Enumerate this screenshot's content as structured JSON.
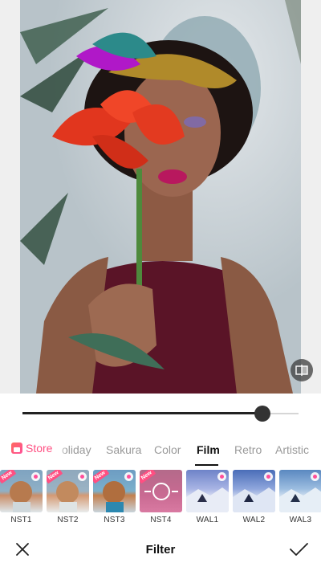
{
  "editor": {
    "title": "Filter",
    "intensity": 0.87
  },
  "tabs": {
    "store_label": "Store",
    "items": [
      "oliday",
      "Sakura",
      "Color",
      "Film",
      "Retro",
      "Artistic"
    ],
    "active": "Film"
  },
  "filters": [
    {
      "name": "NST1",
      "badge": "New",
      "pro": true
    },
    {
      "name": "NST2",
      "badge": "New",
      "pro": true
    },
    {
      "name": "NST3",
      "badge": "New",
      "pro": true
    },
    {
      "name": "NST4",
      "badge": "New",
      "pro": false,
      "selected": true
    },
    {
      "name": "WAL1",
      "badge": "",
      "pro": true
    },
    {
      "name": "WAL2",
      "badge": "",
      "pro": true
    },
    {
      "name": "WAL3",
      "badge": "",
      "pro": true
    }
  ],
  "colors": {
    "accent": "#ff4f82",
    "active_tab": "#111111",
    "inactive_tab": "#9a9a9a"
  },
  "icons": {
    "compare": "compare-icon",
    "store": "store-icon",
    "close": "close-icon",
    "confirm": "checkmark-icon"
  }
}
